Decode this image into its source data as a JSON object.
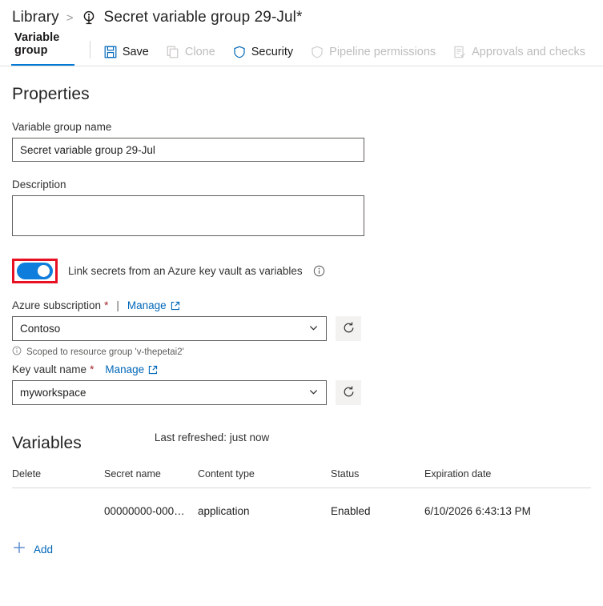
{
  "breadcrumb": {
    "root_label": "Library",
    "separator": ">",
    "icon": "variable-group-icon",
    "title": "Secret variable group 29-Jul*"
  },
  "toolbar": {
    "tab_label": "Variable group",
    "buttons": [
      {
        "label": "Save",
        "icon": "save-icon",
        "enabled": true
      },
      {
        "label": "Clone",
        "icon": "clone-icon",
        "enabled": false
      },
      {
        "label": "Security",
        "icon": "shield-icon",
        "enabled": true
      },
      {
        "label": "Pipeline permissions",
        "icon": "shield-icon",
        "enabled": false
      },
      {
        "label": "Approvals and checks",
        "icon": "checklist-icon",
        "enabled": false
      }
    ]
  },
  "properties": {
    "section_title": "Properties",
    "name_label": "Variable group name",
    "name_value": "Secret variable group 29-Jul",
    "name_placeholder": "",
    "description_label": "Description",
    "description_value": "",
    "description_placeholder": ""
  },
  "link_secrets": {
    "toggle_on": true,
    "label": "Link secrets from an Azure key vault as variables",
    "info_icon": "info-circle-icon",
    "highlight_color": "#e81123",
    "toggle_color": "#0f7ddb"
  },
  "azure_subscription": {
    "label": "Azure subscription",
    "required_mark": "*",
    "separator": "|",
    "manage_label": "Manage",
    "manage_icon": "external-link-icon",
    "selected_value": "Contoso",
    "refresh_icon": "refresh-icon",
    "scope_note_icon": "info-circle-icon",
    "scope_note": "Scoped to resource group 'v-thepetai2'"
  },
  "key_vault": {
    "label": "Key vault name",
    "required_mark": "*",
    "manage_label": "Manage",
    "manage_icon": "external-link-icon",
    "selected_value": "myworkspace",
    "refresh_icon": "refresh-icon"
  },
  "variables": {
    "section_title": "Variables",
    "last_refreshed": "Last refreshed: just now",
    "columns": [
      "Delete",
      "Secret name",
      "Content type",
      "Status",
      "Expiration date"
    ],
    "rows": [
      {
        "delete": "",
        "secret_name": "00000000-000…",
        "content_type": "application",
        "status": "Enabled",
        "expiration_date": "6/10/2026 6:43:13 PM"
      }
    ],
    "add_label": "Add",
    "add_icon": "plus-icon"
  },
  "colors": {
    "accent": "#0078d4",
    "link": "#0067b8",
    "required": "#a4262c",
    "disabled_text": "#bdbdbd",
    "annotation": "#e81123"
  }
}
